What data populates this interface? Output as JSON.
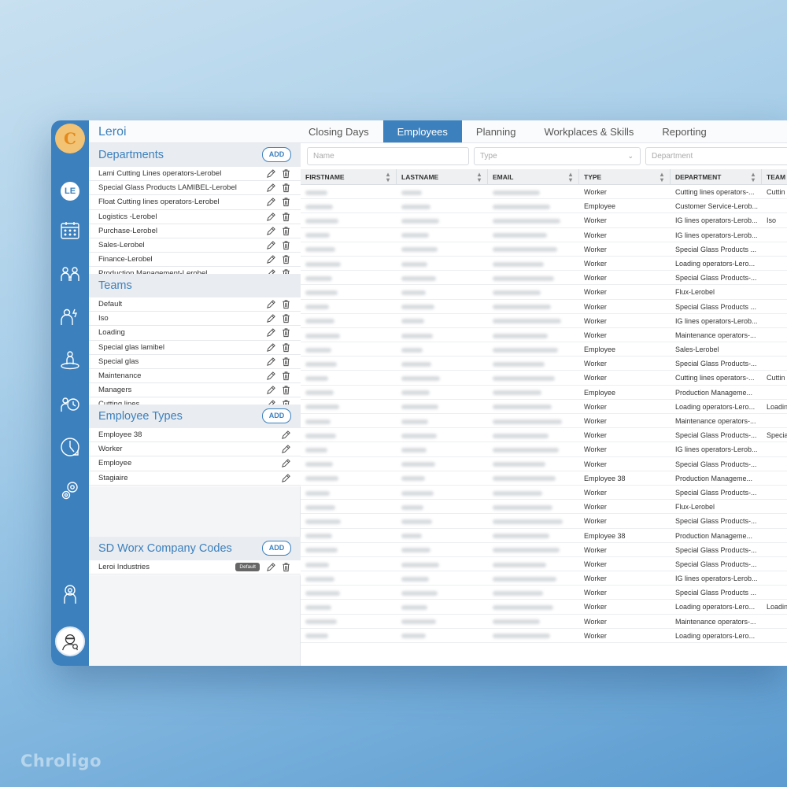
{
  "company": "Leroi",
  "user_initials": "LE",
  "watermark": "Chroligo",
  "tabs": [
    {
      "label": "Closing Days"
    },
    {
      "label": "Employees",
      "active": true
    },
    {
      "label": "Planning"
    },
    {
      "label": "Workplaces & Skills"
    },
    {
      "label": "Reporting"
    }
  ],
  "departments": {
    "title": "Departments",
    "add_label": "ADD",
    "items": [
      "Lami Cutting Lines operators-Lerobel",
      "Special Glass Products LAMIBEL-Lerobel",
      "Float Cutting lines operators-Lerobel",
      "Logistics -Lerobel",
      "Purchase-Lerobel",
      "Sales-Lerobel",
      "Finance-Lerobel",
      "Production Management-Lerobel"
    ]
  },
  "teams": {
    "title": "Teams",
    "items": [
      "Default",
      "Iso",
      "Loading",
      "Special glas lamibel",
      "Special glas",
      "Maintenance",
      "Managers",
      "Cutting lines"
    ]
  },
  "employee_types": {
    "title": "Employee Types",
    "add_label": "ADD",
    "items": [
      "Employee 38",
      "Worker",
      "Employee",
      "Stagiaire"
    ]
  },
  "company_codes": {
    "title": "SD Worx Company Codes",
    "add_label": "ADD",
    "items": [
      {
        "name": "Leroi Industries",
        "badge": "Default"
      }
    ]
  },
  "filters": {
    "name_placeholder": "Name",
    "type_placeholder": "Type",
    "department_placeholder": "Department"
  },
  "table": {
    "columns": [
      "FIRSTNAME",
      "LASTNAME",
      "EMAIL",
      "TYPE",
      "DEPARTMENT",
      "TEAM"
    ],
    "rows": [
      {
        "type": "Worker",
        "department": "Cutting lines operators-...",
        "team": "Cuttin"
      },
      {
        "type": "Employee",
        "department": "Customer Service-Lerob...",
        "team": ""
      },
      {
        "type": "Worker",
        "department": "IG lines operators-Lerob...",
        "team": "Iso"
      },
      {
        "type": "Worker",
        "department": "IG lines operators-Lerob...",
        "team": ""
      },
      {
        "type": "Worker",
        "department": "Special Glass Products ...",
        "team": ""
      },
      {
        "type": "Worker",
        "department": "Loading operators-Lero...",
        "team": ""
      },
      {
        "type": "Worker",
        "department": "Special Glass Products-...",
        "team": ""
      },
      {
        "type": "Worker",
        "department": "Flux-Lerobel",
        "team": ""
      },
      {
        "type": "Worker",
        "department": "Special Glass Products ...",
        "team": ""
      },
      {
        "type": "Worker",
        "department": "IG lines operators-Lerob...",
        "team": ""
      },
      {
        "type": "Worker",
        "department": "Maintenance operators-...",
        "team": ""
      },
      {
        "type": "Employee",
        "department": "Sales-Lerobel",
        "team": ""
      },
      {
        "type": "Worker",
        "department": "Special Glass Products-...",
        "team": ""
      },
      {
        "type": "Worker",
        "department": "Cutting lines operators-...",
        "team": "Cuttin"
      },
      {
        "type": "Employee",
        "department": "Production Manageme...",
        "team": ""
      },
      {
        "type": "Worker",
        "department": "Loading operators-Lero...",
        "team": "Loadin"
      },
      {
        "type": "Worker",
        "department": "Maintenance operators-...",
        "team": ""
      },
      {
        "type": "Worker",
        "department": "Special Glass Products-...",
        "team": "Specia"
      },
      {
        "type": "Worker",
        "department": "IG lines operators-Lerob...",
        "team": ""
      },
      {
        "type": "Worker",
        "department": "Special Glass Products-...",
        "team": ""
      },
      {
        "type": "Employee 38",
        "department": "Production Manageme...",
        "team": ""
      },
      {
        "type": "Worker",
        "department": "Special Glass Products-...",
        "team": ""
      },
      {
        "type": "Worker",
        "department": "Flux-Lerobel",
        "team": ""
      },
      {
        "type": "Worker",
        "department": "Special Glass Products-...",
        "team": ""
      },
      {
        "type": "Employee 38",
        "department": "Production Manageme...",
        "team": ""
      },
      {
        "type": "Worker",
        "department": "Special Glass Products-...",
        "team": ""
      },
      {
        "type": "Worker",
        "department": "Special Glass Products-...",
        "team": ""
      },
      {
        "type": "Worker",
        "department": "IG lines operators-Lerob...",
        "team": ""
      },
      {
        "type": "Worker",
        "department": "Special Glass Products ...",
        "team": ""
      },
      {
        "type": "Worker",
        "department": "Loading operators-Lero...",
        "team": "Loadin"
      },
      {
        "type": "Worker",
        "department": "Maintenance operators-...",
        "team": ""
      },
      {
        "type": "Worker",
        "department": "Loading operators-Lero...",
        "team": ""
      }
    ]
  }
}
